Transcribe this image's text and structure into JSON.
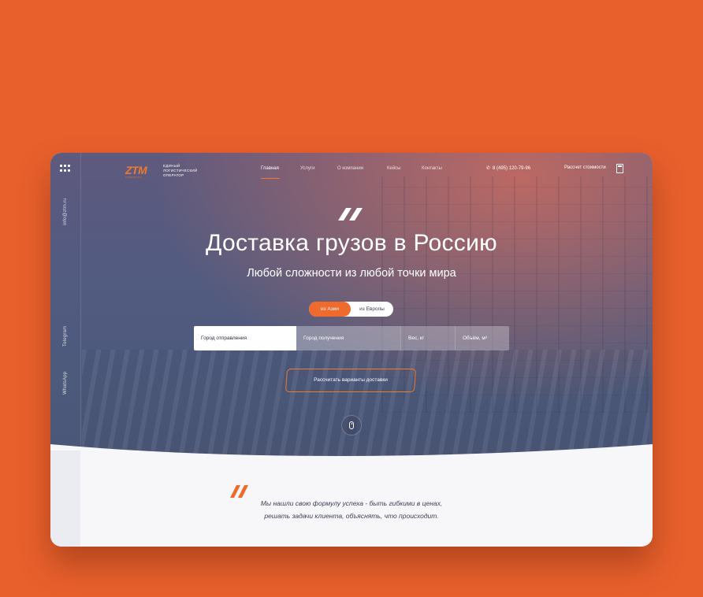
{
  "header": {
    "logo_mark": "ZTM",
    "logo_sub": "LOGISTICS",
    "logo_text": "Единый логистический оператор",
    "nav": [
      {
        "label": "Главная",
        "active": true
      },
      {
        "label": "Услуги"
      },
      {
        "label": "О компании"
      },
      {
        "label": "Кейсы"
      },
      {
        "label": "Контакты"
      }
    ],
    "phone": "8 (495) 120-79-96",
    "calc_label": "Рассчет стоимости"
  },
  "sidebar": {
    "email": "info@ztm.ru",
    "telegram": "Telegram",
    "whatsapp": "WhatsApp"
  },
  "hero": {
    "title": "Доставка грузов в Россию",
    "subtitle": "Любой сложности из любой точки мира",
    "toggle": {
      "active": "из Азии",
      "other": "из Европы"
    },
    "form": {
      "from_placeholder": "Город отправления",
      "to_placeholder": "Город получения",
      "weight_placeholder": "Вес, кг",
      "volume_placeholder": "Объём, м³"
    },
    "cta": "Рассчитать варианты доставки"
  },
  "quote": {
    "line1": "Мы нашли свою формулу успеха - быть гибкими в ценах,",
    "line2": "решать задачи клиента, объяснять, что происходит."
  },
  "colors": {
    "background": "#e8602c",
    "accent": "#ef6a2c",
    "hero_top": "#5e5a7e",
    "hero_bottom": "#4a5676",
    "text_dark": "#3a3f55"
  }
}
